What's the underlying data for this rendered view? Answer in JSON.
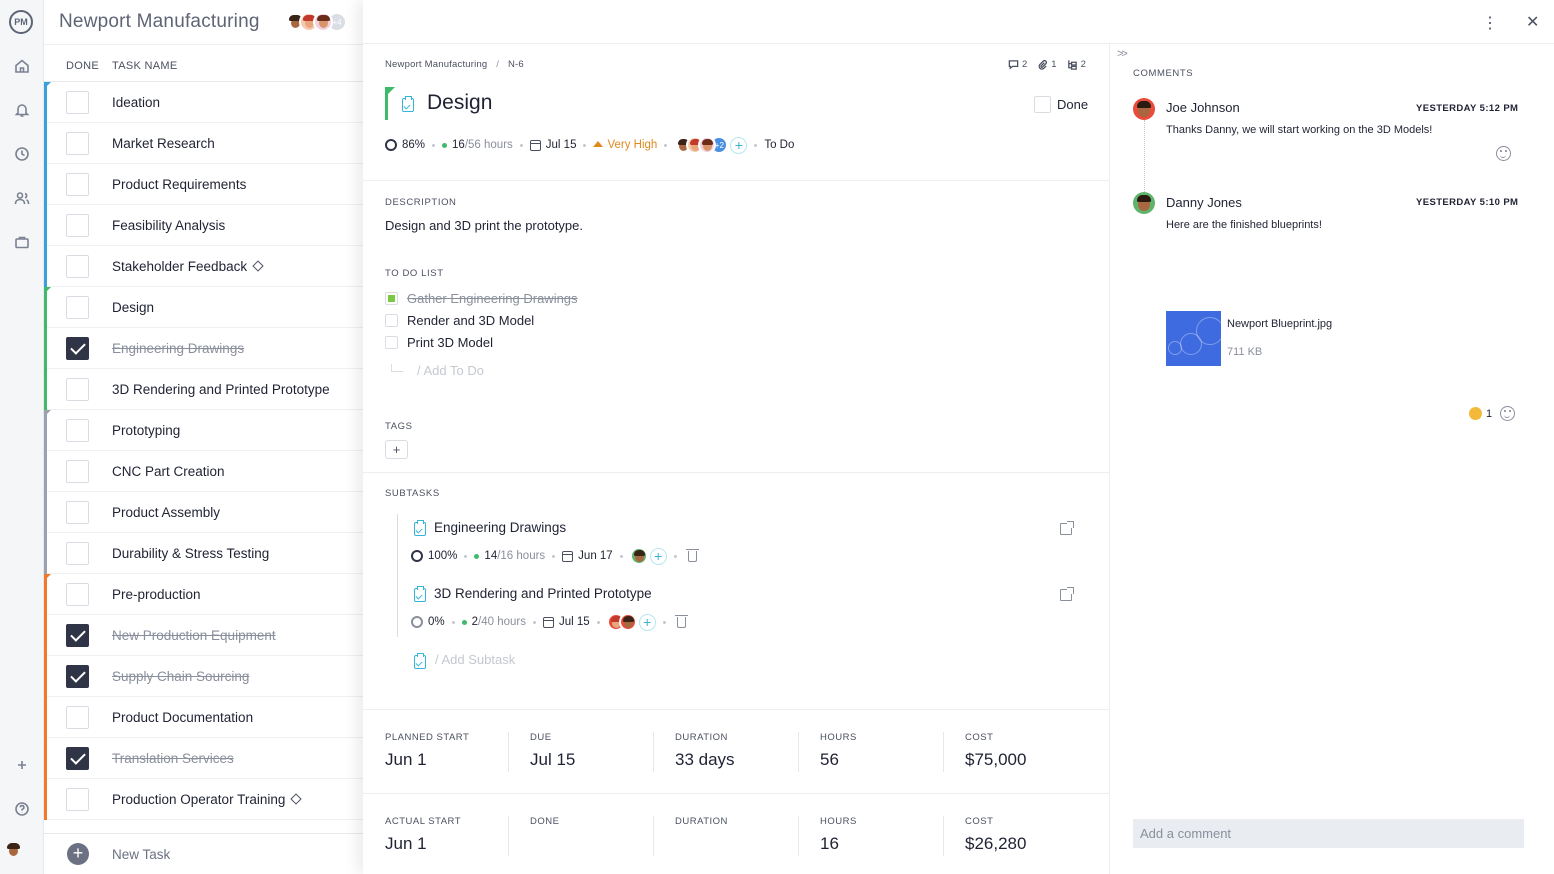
{
  "rail": {
    "logo": "PM",
    "icons": [
      "home-icon",
      "notification-icon",
      "clock-icon",
      "people-icon",
      "briefcase-icon",
      "plus-icon",
      "help-icon",
      "user-avatar"
    ]
  },
  "project": {
    "title": "Newport Manufacturing",
    "extra_members": "+4"
  },
  "list": {
    "headers": {
      "done": "DONE",
      "task_name": "TASK NAME"
    },
    "tasks": [
      {
        "name": "Ideation",
        "done": false,
        "group_color": "#3aa0d9",
        "milestone": false
      },
      {
        "name": "Market Research",
        "done": false,
        "group_color": "#3aa0d9",
        "milestone": false
      },
      {
        "name": "Product Requirements",
        "done": false,
        "group_color": "#3aa0d9",
        "milestone": false
      },
      {
        "name": "Feasibility Analysis",
        "done": false,
        "group_color": "#3aa0d9",
        "milestone": false
      },
      {
        "name": "Stakeholder Feedback",
        "done": false,
        "group_color": "#3aa0d9",
        "milestone": true
      },
      {
        "name": "Design",
        "done": false,
        "group_color": "#3fba6a",
        "milestone": false
      },
      {
        "name": "Engineering Drawings",
        "done": true,
        "group_color": "#3fba6a",
        "milestone": false
      },
      {
        "name": "3D Rendering and Printed Prototype",
        "done": false,
        "group_color": "#3fba6a",
        "milestone": false
      },
      {
        "name": "Prototyping",
        "done": false,
        "group_color": "#9ba1ad",
        "milestone": false
      },
      {
        "name": "CNC Part Creation",
        "done": false,
        "group_color": "#9ba1ad",
        "milestone": false
      },
      {
        "name": "Product Assembly",
        "done": false,
        "group_color": "#9ba1ad",
        "milestone": false
      },
      {
        "name": "Durability & Stress Testing",
        "done": false,
        "group_color": "#9ba1ad",
        "milestone": false
      },
      {
        "name": "Pre-production",
        "done": false,
        "group_color": "#f07a2b",
        "milestone": false
      },
      {
        "name": "New Production Equipment",
        "done": true,
        "group_color": "#f07a2b",
        "milestone": false
      },
      {
        "name": "Supply Chain Sourcing",
        "done": true,
        "group_color": "#f07a2b",
        "milestone": false
      },
      {
        "name": "Product Documentation",
        "done": false,
        "group_color": "#f07a2b",
        "milestone": false
      },
      {
        "name": "Translation Services",
        "done": true,
        "group_color": "#f07a2b",
        "milestone": false
      },
      {
        "name": "Production Operator Training",
        "done": false,
        "group_color": "#f07a2b",
        "milestone": true
      }
    ],
    "new_task": "New Task"
  },
  "detail": {
    "breadcrumb": {
      "project": "Newport Manufacturing",
      "separator": "/",
      "id": "N-6"
    },
    "counts": {
      "comments": "2",
      "attachments": "1",
      "subtasks": "2"
    },
    "title": "Design",
    "done_label": "Done",
    "stats": {
      "progress": "86%",
      "hours_done": "16",
      "hours_total": "/56 hours",
      "due": "Jul 15",
      "priority": "Very High",
      "extra_assignees": "+2",
      "status": "To Do"
    },
    "description_label": "DESCRIPTION",
    "description": "Design and 3D print the prototype.",
    "todo_label": "TO DO LIST",
    "todos": [
      {
        "text": "Gather Engineering Drawings",
        "done": true
      },
      {
        "text": "Render and 3D Model",
        "done": false
      },
      {
        "text": "Print 3D Model",
        "done": false
      }
    ],
    "add_todo": "/ Add To Do",
    "tags_label": "TAGS",
    "tags_add": "+",
    "subtasks_label": "SUBTASKS",
    "subtasks": [
      {
        "title": "Engineering Drawings",
        "progress": "100%",
        "hours_done": "14",
        "hours_total": "/16 hours",
        "due": "Jun 17"
      },
      {
        "title": "3D Rendering and Printed Prototype",
        "progress": "0%",
        "hours_done": "2",
        "hours_total": "/40 hours",
        "due": "Jul 15"
      }
    ],
    "add_subtask": "/ Add Subtask",
    "planned": [
      {
        "label": "PLANNED START",
        "value": "Jun 1"
      },
      {
        "label": "DUE",
        "value": "Jul 15"
      },
      {
        "label": "DURATION",
        "value": "33 days"
      },
      {
        "label": "HOURS",
        "value": "56"
      },
      {
        "label": "COST",
        "value": "$75,000"
      }
    ],
    "actual": [
      {
        "label": "ACTUAL START",
        "value": "Jun 1"
      },
      {
        "label": "DONE",
        "value": ""
      },
      {
        "label": "DURATION",
        "value": ""
      },
      {
        "label": "HOURS",
        "value": "16"
      },
      {
        "label": "COST",
        "value": "$26,280"
      }
    ]
  },
  "comments": {
    "label": "COMMENTS",
    "items": [
      {
        "author": "Joe Johnson",
        "time": "YESTERDAY 5:12 PM",
        "text": "Thanks Danny, we will start working on the 3D Models!"
      },
      {
        "author": "Danny Jones",
        "time": "YESTERDAY 5:10 PM",
        "text": "Here are the finished blueprints!"
      }
    ],
    "attachment": {
      "name": "Newport Blueprint.jpg",
      "size": "711 KB"
    },
    "reaction_count": "1",
    "input_placeholder": "Add a comment"
  }
}
